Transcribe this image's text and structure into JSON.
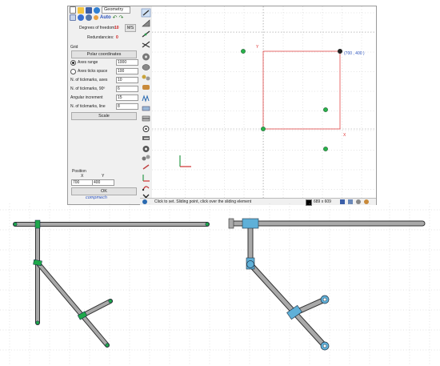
{
  "toolbar": {
    "workspace_value": "Geometry",
    "auto_label": "Auto",
    "icons": [
      "new-file-icon",
      "open-folder-icon",
      "save-icon",
      "globe-icon",
      "undo-icon",
      "redo-icon"
    ]
  },
  "panel": {
    "dof_label": "Degrees of freedom:",
    "dof_value": "10",
    "ms_label": "MS",
    "redundancies_label": "Redundancies:",
    "redundancies_value": "0",
    "grid_label": "Grid",
    "polar_button": "Polar coordinates",
    "axes_range_label": "Axes range",
    "axes_range_value": "1000",
    "axes_ticks_label": "Axes ticks space",
    "axes_ticks_value": "100",
    "tickmarks_axes_label": "N. of tickmarks, axes",
    "tickmarks_axes_value": "10",
    "tickmarks_90_label": "N. of tickmarks, 90º",
    "tickmarks_90_value": "6",
    "angular_label": "Angular increment",
    "angular_value": "15",
    "tickmarks_line_label": "N. of tickmarks, line",
    "tickmarks_line_value": "8",
    "scale_button": "Scale",
    "position_label": "Position",
    "x_label": "X",
    "y_label": "Y",
    "x_value": "700",
    "y_value": "400",
    "ok_button": "OK",
    "logo_text": "compmech"
  },
  "canvas": {
    "y_axis_label": "Y",
    "x_axis_label": "X",
    "point_label": "(700 , 400 )"
  },
  "status": {
    "message": "Click to set. Sliding point, click over the sliding element",
    "size": "689 x 609"
  },
  "colors": {
    "link_fill": "#a9a9a9",
    "joint_green": "#1ea84a",
    "joint_blue": "#5fb0d8",
    "axis_red": "#e03030",
    "point_green": "#27b24a",
    "grid_dot": "#9a9a9a"
  }
}
